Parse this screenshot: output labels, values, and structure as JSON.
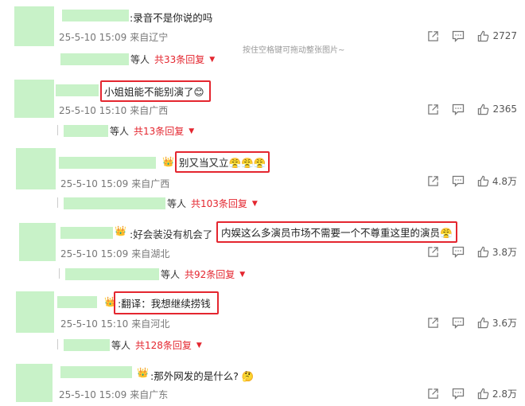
{
  "hint": "按住空格键可拖动整张图片~",
  "people_label": "等人",
  "comments": [
    {
      "text": "录音不是你说的吗",
      "prefix": ":",
      "date": "25-5-10 15:09",
      "location": "来自辽宁",
      "likes": "2727",
      "reply_count": "共33条回复"
    },
    {
      "text": "小姐姐能不能别演了",
      "emoji": "😊",
      "date": "25-5-10 15:10",
      "location": "来自广西",
      "likes": "2365",
      "reply_count": "共13条回复"
    },
    {
      "text": "别又当又立",
      "emoji": "😤😤😤",
      "date": "25-5-10 15:09",
      "location": "来自广西",
      "likes": "4.8万",
      "reply_count": "共103条回复"
    },
    {
      "text_plain": ":好会装没有机会了",
      "text": "内娱这么多演员市场不需要一个不尊重这里的演员",
      "date": "25-5-10 15:09",
      "location": "来自湖北",
      "likes": "3.8万",
      "reply_count": "共92条回复"
    },
    {
      "text": ":翻译：我想继续捞钱",
      "date": "25-5-10 15:10",
      "location": "来自河北",
      "likes": "3.6万",
      "reply_count": "共128条回复"
    },
    {
      "text": ":那外网发的是什么?",
      "emoji": "🤔",
      "date": "25-5-10 15:09",
      "location": "来自广东",
      "likes": "2.8万"
    }
  ],
  "icons": {
    "share": "share-icon",
    "comment": "comment-icon",
    "like": "like-icon",
    "crown": "crown-icon"
  },
  "colors": {
    "highlight": "#e4262f",
    "redact": "#c8f2c8"
  }
}
